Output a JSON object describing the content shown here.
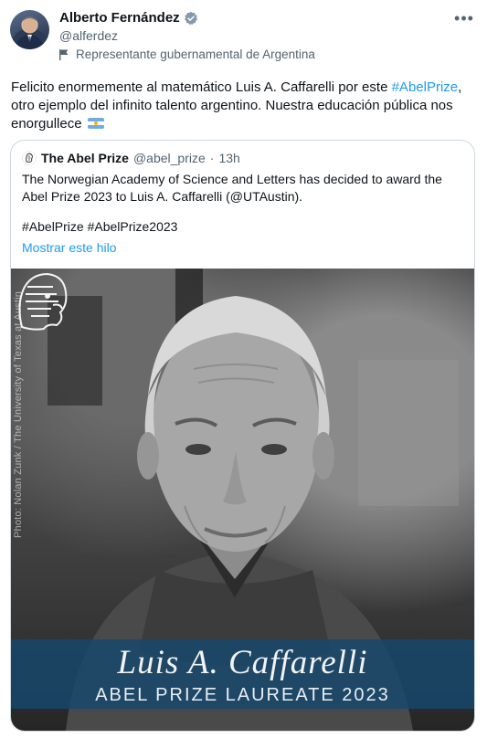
{
  "author": {
    "name": "Alberto Fernández",
    "handle": "@alferdez",
    "affiliation": "Representante gubernamental de Argentina"
  },
  "tweet": {
    "text_before": "Felicito enormemente al matemático Luis A. Caffarelli por este ",
    "hashtag": "#AbelPrize",
    "text_after": ", otro ejemplo del infinito talento argentino. Nuestra educación pública nos enorgullece"
  },
  "quoted": {
    "name": "The Abel Prize",
    "handle": "@abel_prize",
    "separator": "·",
    "time": "13h",
    "text": "The Norwegian Academy of Science and Letters has decided to award the Abel Prize 2023 to Luis A. Caffarelli (@UTAustin).",
    "hashtags": "#AbelPrize #AbelPrize2023",
    "show_thread": "Mostrar este hilo",
    "image": {
      "credit": "Photo: Nolan Zunk / The University of Texas at Austin",
      "title": "Luis A. Caffarelli",
      "subtitle": "ABEL PRIZE LAUREATE 2023"
    }
  },
  "icons": {
    "verified": "verified-badge-icon",
    "affiliation": "flag-icon",
    "more": "more-icon"
  },
  "colors": {
    "accent": "#1d9bf0",
    "banner": "#16486e"
  }
}
